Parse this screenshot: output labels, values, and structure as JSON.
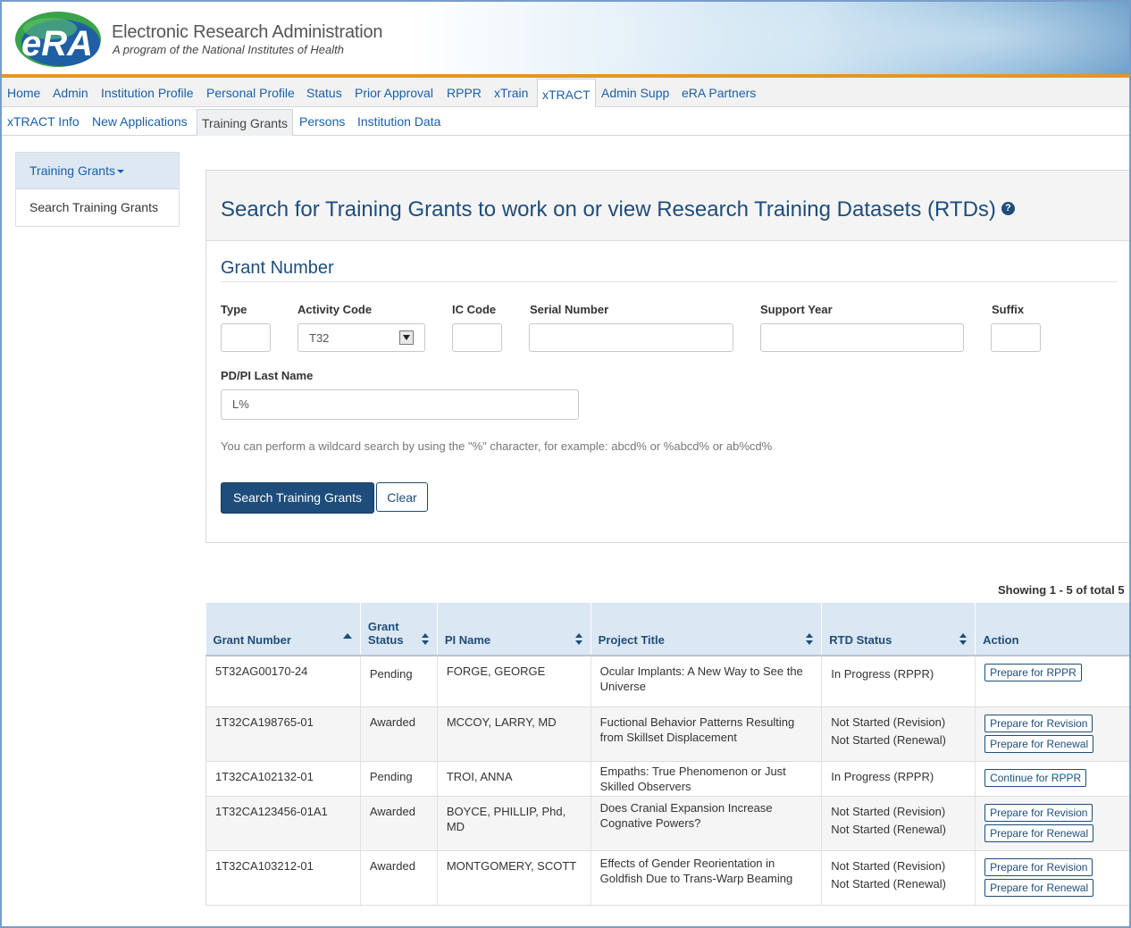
{
  "header": {
    "logo_text": "eRA",
    "title": "Electronic Research Administration",
    "subtitle": "A program of the National Institutes of Health"
  },
  "main_nav": [
    "Home",
    "Admin",
    "Institution Profile",
    "Personal Profile",
    "Status",
    "Prior Approval",
    "RPPR",
    "xTrain",
    "xTRACT",
    "Admin Supp",
    "eRA Partners"
  ],
  "sub_nav": [
    "xTRACT Info",
    "New Applications",
    "Training Grants",
    "Persons",
    "Institution Data"
  ],
  "side_menu": {
    "heading": "Training Grants",
    "items": [
      "Search Training Grants"
    ]
  },
  "search": {
    "title": "Search for Training Grants to work on or view Research Training Datasets (RTDs)",
    "section_title": "Grant Number",
    "labels": {
      "type": "Type",
      "activity_code": "Activity Code",
      "ic_code": "IC Code",
      "serial_number": "Serial Number",
      "support_year": "Support Year",
      "suffix": "Suffix",
      "pi_last_name": "PD/PI Last Name"
    },
    "values": {
      "type": "",
      "activity_code": "T32",
      "ic_code": "",
      "serial_number": "",
      "support_year": "",
      "suffix": "",
      "pi_last_name": "L%"
    },
    "hint": "You can perform a wildcard search by using the \"%\" character, for example: abcd% or %abcd% or ab%cd%",
    "search_button": "Search Training Grants",
    "clear_button": "Clear"
  },
  "results": {
    "showing": "Showing 1 - 5 of total 5",
    "columns": [
      "Grant Number",
      "Grant Status",
      "PI Name",
      "Project Title",
      "RTD Status",
      "Action"
    ],
    "rows": [
      {
        "grant": "5T32AG00170-24",
        "status": "Pending",
        "pi": "FORGE, GEORGE",
        "title": "Ocular Implants: A New Way to See the Universe",
        "rtd": [
          "In Progress (RPPR)"
        ],
        "actions": [
          "Prepare for RPPR"
        ]
      },
      {
        "grant": "1T32CA198765-01",
        "status": "Awarded",
        "pi": "MCCOY, LARRY, MD",
        "title": "Fuctional Behavior Patterns Resulting from Skillset Displacement",
        "rtd": [
          "Not Started (Revision)",
          "Not Started (Renewal)"
        ],
        "actions": [
          "Prepare for Revision",
          "Prepare for Renewal"
        ]
      },
      {
        "grant": "1T32CA102132-01",
        "status": "Pending",
        "pi": "TROI, ANNA",
        "title": "Empaths: True Phenomenon or Just Skilled Observers",
        "rtd": [
          "In Progress (RPPR)"
        ],
        "actions": [
          "Continue for RPPR"
        ]
      },
      {
        "grant": "1T32CA123456-01A1",
        "status": "Awarded",
        "pi": "BOYCE, PHILLIP, Phd, MD",
        "title": "Does Cranial Expansion Increase Cognative Powers?",
        "rtd": [
          "Not Started (Revision)",
          "Not Started (Renewal)"
        ],
        "actions": [
          "Prepare for Revision",
          "Prepare for Renewal"
        ]
      },
      {
        "grant": "1T32CA103212-01",
        "status": "Awarded",
        "pi": "MONTGOMERY, SCOTT",
        "title": "Effects of Gender Reorientation in Goldfish Due to Trans-Warp Beaming",
        "rtd": [
          "Not Started (Revision)",
          "Not Started (Renewal)"
        ],
        "actions": [
          "Prepare for Revision",
          "Prepare for Renewal"
        ]
      }
    ]
  }
}
